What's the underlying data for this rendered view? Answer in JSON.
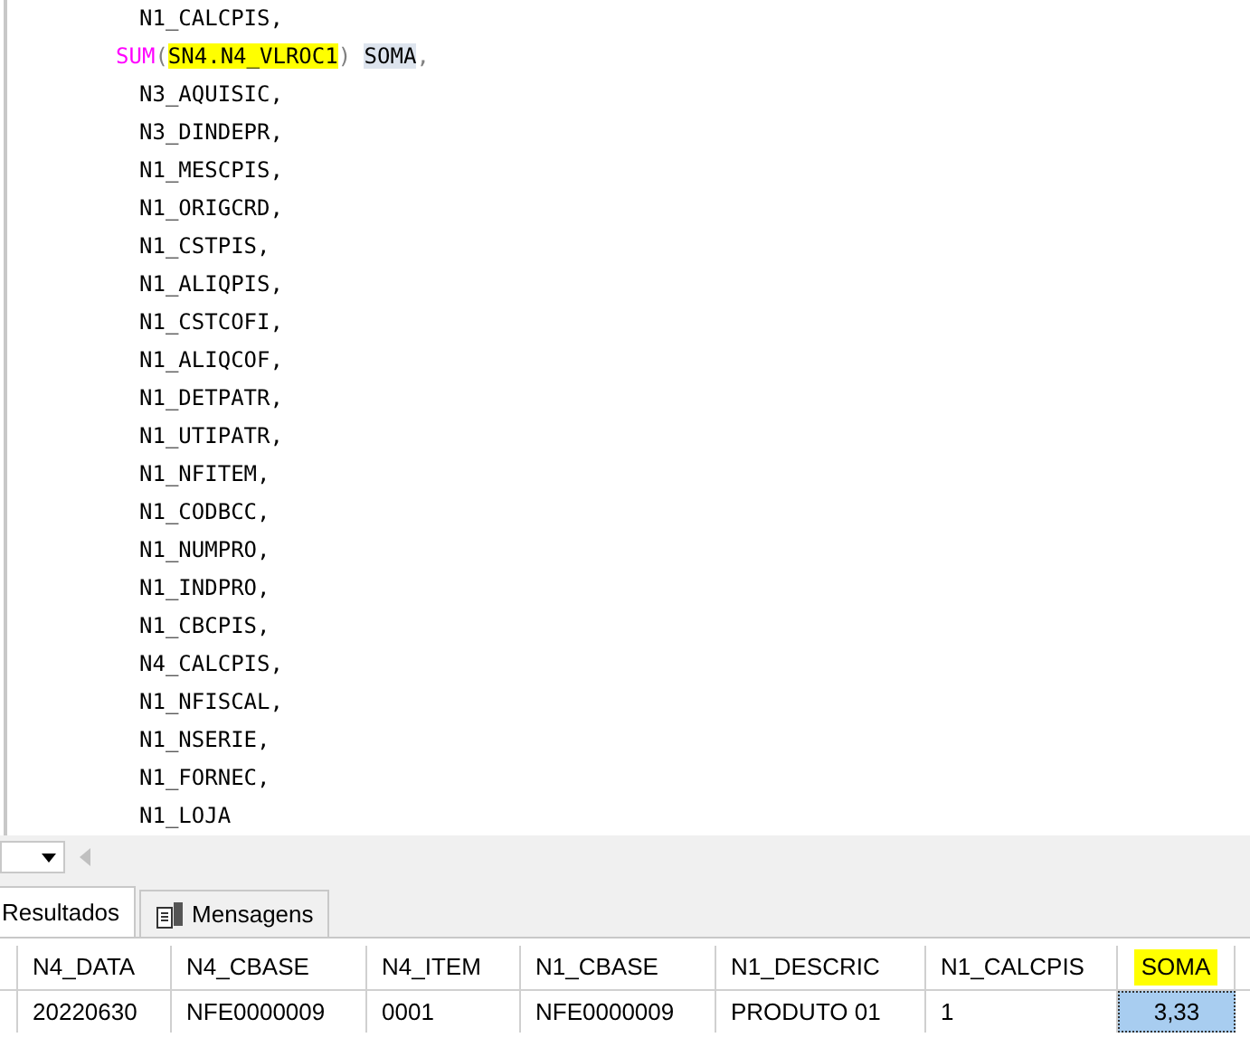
{
  "editor": {
    "lines": [
      {
        "kind": "column",
        "segments": [
          {
            "text": "N1_CALCPIS,",
            "kind": "text"
          }
        ]
      },
      {
        "kind": "aggregate",
        "segments": [
          {
            "text": "SUM",
            "kind": "keyword"
          },
          {
            "text": "(",
            "kind": "punct"
          },
          {
            "text": "SN4.N4_VLROC1",
            "kind": "highlight"
          },
          {
            "text": ") ",
            "kind": "punct"
          },
          {
            "text": "SOMA",
            "kind": "selection"
          },
          {
            "text": ",",
            "kind": "punct"
          }
        ]
      },
      {
        "kind": "column",
        "segments": [
          {
            "text": "N3_AQUISIC,",
            "kind": "text"
          }
        ]
      },
      {
        "kind": "column",
        "segments": [
          {
            "text": "N3_DINDEPR,",
            "kind": "text"
          }
        ]
      },
      {
        "kind": "column",
        "segments": [
          {
            "text": "N1_MESCPIS,",
            "kind": "text"
          }
        ]
      },
      {
        "kind": "column",
        "segments": [
          {
            "text": "N1_ORIGCRD,",
            "kind": "text"
          }
        ]
      },
      {
        "kind": "column",
        "segments": [
          {
            "text": "N1_CSTPIS,",
            "kind": "text"
          }
        ]
      },
      {
        "kind": "column",
        "segments": [
          {
            "text": "N1_ALIQPIS,",
            "kind": "text"
          }
        ]
      },
      {
        "kind": "column",
        "segments": [
          {
            "text": "N1_CSTCOFI,",
            "kind": "text"
          }
        ]
      },
      {
        "kind": "column",
        "segments": [
          {
            "text": "N1_ALIQCOF,",
            "kind": "text"
          }
        ]
      },
      {
        "kind": "column",
        "segments": [
          {
            "text": "N1_DETPATR,",
            "kind": "text"
          }
        ]
      },
      {
        "kind": "column",
        "segments": [
          {
            "text": "N1_UTIPATR,",
            "kind": "text"
          }
        ]
      },
      {
        "kind": "column",
        "segments": [
          {
            "text": "N1_NFITEM,",
            "kind": "text"
          }
        ]
      },
      {
        "kind": "column",
        "segments": [
          {
            "text": "N1_CODBCC,",
            "kind": "text"
          }
        ]
      },
      {
        "kind": "column",
        "segments": [
          {
            "text": "N1_NUMPRO,",
            "kind": "text"
          }
        ]
      },
      {
        "kind": "column",
        "segments": [
          {
            "text": "N1_INDPRO,",
            "kind": "text"
          }
        ]
      },
      {
        "kind": "column",
        "segments": [
          {
            "text": "N1_CBCPIS,",
            "kind": "text"
          }
        ]
      },
      {
        "kind": "column",
        "segments": [
          {
            "text": "N4_CALCPIS,",
            "kind": "text"
          }
        ]
      },
      {
        "kind": "column",
        "segments": [
          {
            "text": "N1_NFISCAL,",
            "kind": "text"
          }
        ]
      },
      {
        "kind": "column",
        "segments": [
          {
            "text": "N1_NSERIE,",
            "kind": "text"
          }
        ]
      },
      {
        "kind": "column",
        "segments": [
          {
            "text": "N1_FORNEC,",
            "kind": "text"
          }
        ]
      },
      {
        "kind": "column",
        "segments": [
          {
            "text": "N1_LOJA",
            "kind": "text"
          }
        ]
      }
    ]
  },
  "tabs": [
    {
      "label": "Resultados",
      "selected": true
    },
    {
      "label": "Mensagens",
      "selected": false
    }
  ],
  "grid": {
    "columns": [
      {
        "label": "N4_DATA",
        "highlight": false
      },
      {
        "label": "N4_CBASE",
        "highlight": false
      },
      {
        "label": "N4_ITEM",
        "highlight": false
      },
      {
        "label": "N1_CBASE",
        "highlight": false
      },
      {
        "label": "N1_DESCRIC",
        "highlight": false
      },
      {
        "label": "N1_CALCPIS",
        "highlight": false
      },
      {
        "label": "SOMA",
        "highlight": true
      }
    ],
    "rows": [
      {
        "cells": [
          {
            "text": "20220630",
            "selected": false
          },
          {
            "text": "NFE0000009",
            "selected": false
          },
          {
            "text": "0001",
            "selected": false
          },
          {
            "text": "NFE0000009",
            "selected": false
          },
          {
            "text": "PRODUTO 01",
            "selected": false
          },
          {
            "text": "1",
            "selected": false
          },
          {
            "text": "3,33",
            "selected": true
          }
        ]
      }
    ]
  }
}
